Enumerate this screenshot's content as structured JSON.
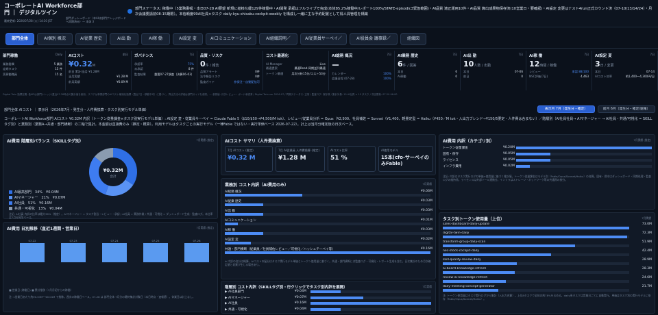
{
  "header": {
    "title": "コーポレートAI Workforce部門 ｜ デジタルツイン",
    "meta": "最終更新: 2026/07/28 (火) 14:10 JST",
    "subtitle": "部門ダッシュボード（本AIは部門ナレッジボードへ同期済み）— 本体 3",
    "status": "部門ステータス: 稼働中（5業務委嘱・本日07-28 AI要望 新規に結核な緩129件稼働中・AI開発 承認はフルライブで完成(本体85.2%稼働中/レポート100%/STATE-episodic3緊急範囲)・AI品質 適正運用10件・AI品質 算出成果物保存済(10営業日・要確認)・AI設定 変更はナスト4run正式カウント済（07-10/13/14/24）・月次会議要請前08-15期限）。本信頼度99AI社員×タスク daily-kyu-shisaku-cockpit-weekly を構成し一緒に主な予約配置として得人員管理を構築"
  },
  "tabs": [
    "部門全体",
    "AI個別 概況",
    "AI従業 歴史",
    "AI出 勤",
    "AI稼 働",
    "AI設定 変",
    "AIコミュニケーション",
    "AI組織説明／",
    "AI従業員サーベイ／",
    "AI役員会 議事録／",
    "組織図"
  ],
  "kpis": [
    {
      "title": "部門稼働",
      "tag": "Daily",
      "big": "",
      "rows": [
        [
          "業務委嘱",
          "5 業務"
        ],
        [
          "定期タスク",
          "15 件"
        ],
        [
          "実稼働職員",
          "15 名"
        ]
      ]
    },
    {
      "title": "AIコスト",
      "tag": "前日",
      "big": "¥0.32",
      "unit": "M",
      "rows": [
        [
          "前日 累計/当月 ¥1.28M",
          ""
        ],
        [
          "当月実績",
          "¥1.28 M"
        ],
        [
          "前月実績",
          "¥0.09 M"
        ]
      ]
    },
    {
      "title": "ガバナンス",
      "tag": "7日",
      "big": "",
      "rows": [
        [
          "承認率",
          "75%"
        ],
        [
          "未承認",
          "8 件"
        ],
        [
          "監査結果",
          "重要07-27調査（決算06-03）"
        ]
      ]
    },
    {
      "title": "品質・リスク",
      "tag": "",
      "big": "0",
      "unit": "件 / 報告",
      "rows": [
        [
          "品質アラート",
          "0件"
        ],
        [
          "法令報告リスク",
          "0件"
        ],
        [
          "監査ガイド",
          "参保注・自動配信可"
        ]
      ]
    },
    {
      "title": "コスト最適化",
      "tag": "",
      "big": "",
      "rows": [
        [
          "AI-Manager",
          "Live"
        ],
        [
          "最適提案",
          "最適Read-同期並列最適"
        ],
        [
          "トークン最適",
          "月次分析15分/コスト53分"
        ]
      ]
    },
    {
      "title": "AI総務 概況",
      "tag": "7日",
      "big": "ー",
      "unit": "",
      "rows": [
        [
          "カレンダー",
          "100%"
        ],
        [
          "会議日程 (07-28)",
          "100%"
        ]
      ]
    },
    {
      "title": "AI業務 歴史",
      "tag": "7日",
      "big": "6",
      "unit": "件 / 回答",
      "rows": [
        [
          "本日",
          "6"
        ],
        [
          "AI稼働",
          "0"
        ]
      ]
    },
    {
      "title": "AI出 勤",
      "tag": "7日",
      "big": "10",
      "unit": "人数 / 出勤",
      "rows": [
        [
          "本日",
          "07-06"
        ],
        [
          "前日",
          "0"
        ]
      ]
    },
    {
      "title": "AI稼 働",
      "tag": "7日",
      "big": "12",
      "unit": "時間 / 稼働",
      "rows": [
        [
          "レビュー",
          "承認 88/100"
        ],
        [
          "NSC評価(7日)",
          "4,463"
        ]
      ]
    },
    {
      "title": "AI設定 変",
      "tag": "7日",
      "big": "3",
      "unit": "日 / 変更",
      "rows": [
        [
          "本日",
          "07-14"
        ],
        [
          "AIコスト効率",
          "約1,400～4,300円/日"
        ]
      ]
    }
  ],
  "note": "Digital Twin 指標定義: 各KPIは部門ナレッジ/直近07-28時点の集計値を使用。スコアは事業部門のAIコスト最適化指標（直近7日・移動平均）に基づく。算出方法の詳細は部門ガイドを参照。— 参照値: 月次レビュー・ボード承認済 / Digital Twin ver 2026.07 / 同期ステータス: 正常 / 監査ログ: 保存済 / 集計対象: 15 AI社員 × 15 タスク / 次回更新: 07-29 06:00",
  "period": {
    "label": "部門全体 AIコスト ｜ 表示月（2026年7月・発生分・人件費換算・タスク別実行モデル単価）",
    "btn_a": "表示月 7月（発生分・確定）",
    "btn_b": "前月 6月（発生分・確定/速報）"
  },
  "description": "コーポレートAI Workforce部門 AIコスト ¥0.32M 内訳（トークン従量課金×タスク別実行モデル単価）: AI設定 変・従業員サーベイ = Claude Fable 5（$10/$50→¥4,500/M tok）、レビュー/従業員分析 = Opus（¥2,900、社員補佐 = Sonnet（¥1,400、軽量定型 = Haiku（¥450／M tok・入出力ブレンド→¥150/5要定・人件費は含まない）／階層別（AI社員社員→ AIマネージャー → AI社員・共通/可視化 = SKILLタグ別）と業務別（業務A→共通・部門横断）の二軸で集計。本金額は直接費のみ（推定・概算）。利用モデルはタスクごとの実行モデル（一律Fable ではない・実行単価ベース 2026-07-22）。計上は当月分確定後の日次ベース。",
  "balance": {
    "title": "AI費用 階層別バランス（SKILLタグ別）",
    "note": "7月実績 (推定)",
    "center_value": "¥0.32M",
    "center_label": "合計",
    "legend": [
      "AI最高部門　34%　¥0.04M",
      "AIマネージャー　21%　¥0.07M",
      "AI社員　51%　¥0.16M",
      "共通・可視化　13%　¥0.04M"
    ],
    "text": "注記: AI社員 内訳の比率は最大36%（推定）。AIマネージャー = タスク割当・レビュー・承認 / AI社員 = 実務作業 / 共通・可視化 = ダッシュボード生成・監査ログ。本比率は7月分発生ベース。"
  },
  "daily": {
    "title": "AI費用 日別推移（直近1週間・営業日）",
    "note": "7月実績 (推定)",
    "days": [
      "07-22",
      "07-23",
      "07-24",
      "07-25",
      "07-28"
    ],
    "text": "■ 営業日 (稼働日) ■ 累計推移（7月月初からの稼働）",
    "text2": "注: 1営業日あたり約¥0.03M～¥0.04M で推移。週次の稼働日ベース。07-28 は 部門全体 7月分の最終集計対象日（本日時点・速報値）。休業日は計上なし。"
  },
  "summary": {
    "title": "AIコスト サマリ（人件費換算）",
    "cards": [
      {
        "label": "7月 AIコスト (推定)",
        "value": "¥0.32 M"
      },
      {
        "label": "7月 AI従業員 人件費換算 (推定)",
        "value": "¥1.28 M"
      },
      {
        "label": "AIコスト比率",
        "value": "51 %"
      },
      {
        "label": "AI使用モデル",
        "value": "15本(cfo-サーベイのみFable)"
      }
    ]
  },
  "business": {
    "title": "業務別 コスト内訳（AI費用のみ）",
    "note": "7月実績",
    "items": [
      {
        "label": "AI総務 概況",
        "value": "¥0.06M"
      },
      {
        "label": "AI従業 歴史",
        "value": "¥0.03M"
      },
      {
        "label": "AI出 勤",
        "value": "¥0.03M"
      },
      {
        "label": "AIコミュニケーション",
        "value": "¥0.01M"
      },
      {
        "label": "AI稼 働",
        "value": "¥0.03M"
      },
      {
        "label": "AI設定 変",
        "value": "¥0.02M"
      },
      {
        "label": "共通・部門横断（従業員／社員補佐レビュー／可視化／ハッシュテーベイ等）",
        "value": "¥0.16M"
      }
    ],
    "text": "※ 内訳の合計は概算。AIコストの配分はタスク実行モデル単価とトークン使用量に基づく。共通・部門横断には監査ログ・可視化・レポート生成を含む。日次集計のため月次確定値と差異が生じる場合あり。"
  },
  "skill": {
    "title": "階層別 コスト内訳（SKILLタグ別・行クリックでタスク別内訳を展開）",
    "note": "7月実績",
    "items": [
      {
        "label": "▶ AI社員部門",
        "value": "¥0.04M"
      },
      {
        "label": "▶ AIマネージャー",
        "value": "¥0.07M"
      },
      {
        "label": "▶ AI社員",
        "value": "¥0.16M"
      },
      {
        "label": "▶ 共通・可視化",
        "value": "¥0.04M"
      }
    ]
  },
  "breakdown": {
    "title": "AI費用 内訳（カテゴリ別）",
    "note": "7月実績 (推定)",
    "items": [
      {
        "label": "トークン従量課金",
        "value": "¥0.20M"
      },
      {
        "label": "固有・保守",
        "value": "¥0.05M"
      },
      {
        "label": "ライセンス",
        "value": "¥0.05M"
      },
      {
        "label": "インフラ費用",
        "value": "¥0.02M"
      }
    ],
    "text": "注記: 内訳はタスク実行ログの単価×使用量に基づく推計値。トークン従量課金はモデル別（Fable/Opus/Sonnet/Haiku）の合算。固有・保守はダッシュボード・同期処理・監査ログの維持費。ライセンスは外部ツール連携分。インフラはストレージ・ネットワーク等の共通費の按分。"
  },
  "tokens": {
    "title": "タスク別トークン使用量（上位）",
    "note": "7月実績",
    "items": [
      {
        "label": "sales-dashboard-daily-update",
        "value": "73.0M"
      },
      {
        "label": "digital-twin-daily",
        "value": "72.3M"
      },
      {
        "label": "transform-group-daily-scan",
        "value": "51.9M"
      },
      {
        "label": "nec-stock-cockpit-daily",
        "value": "42.4M"
      },
      {
        "label": "skill-quality-review-daily",
        "value": "28.9M"
      },
      {
        "label": "ai-board-knowledge-refresh",
        "value": "28.3M"
      },
      {
        "label": "review-ai-knowledge-refresh",
        "value": "24.6M"
      },
      {
        "label": "daily-meeting-concept-generator",
        "value": "21.7M"
      }
    ],
    "text": "注: トークン使用量はタスク実行ログから集計（入出力合算）。上位8タスクで全体の約78%を占める。daily系タスクは営業日ごとに自動実行。単価はタスク別の実行モデルに依存（Fable/Opus/Sonnet/Haiku）。"
  },
  "colors": {
    "accent": "#2a5fd0",
    "bar": "#4d8cf5",
    "donut": [
      "#2f6fe6",
      "#5a93f4",
      "#3e7cf0",
      "#8a9bb0"
    ]
  }
}
